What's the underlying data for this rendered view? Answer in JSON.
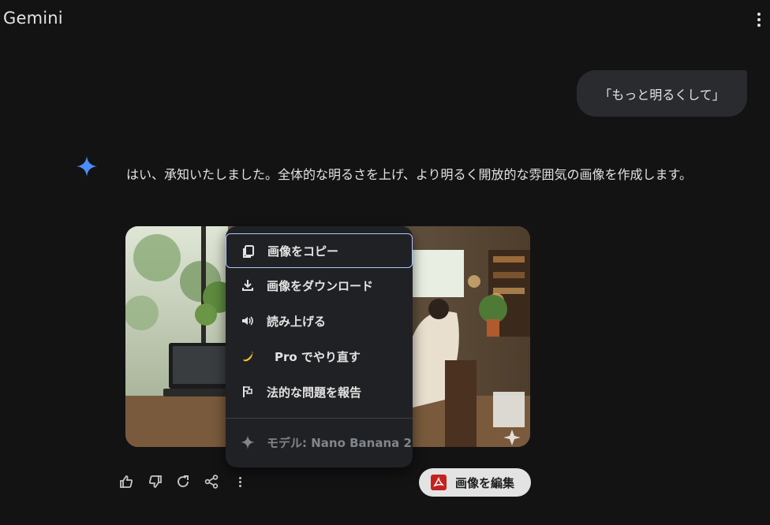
{
  "app": {
    "title": "Gemini"
  },
  "conversation": {
    "user_message": "「もっと明るくして」",
    "response_text": "はい、承知いたしました。全体的な明るさを上げ、より明るく開放的な雰囲気の画像を作成します。"
  },
  "context_menu": {
    "items": [
      {
        "label": "画像をコピー",
        "icon": "copy-icon"
      },
      {
        "label": "画像をダウンロード",
        "icon": "download-icon"
      },
      {
        "label": "読み上げる",
        "icon": "speaker-icon"
      },
      {
        "label": "Pro でやり直す",
        "icon": "banana-icon"
      },
      {
        "label": "法的な問題を報告",
        "icon": "flag-icon"
      }
    ],
    "model_label": "モデル: Nano Banana 2"
  },
  "actions": {
    "icons": [
      "thumbs-up-icon",
      "thumbs-down-icon",
      "redo-icon",
      "share-icon",
      "more-vert-icon"
    ],
    "edit_image_label": "画像を編集"
  },
  "colors": {
    "background": "#131314",
    "bubble": "#2a2b2e",
    "menu": "#202124",
    "spark_blue": "#4c8df6",
    "focus_ring": "#a8c7fa"
  }
}
